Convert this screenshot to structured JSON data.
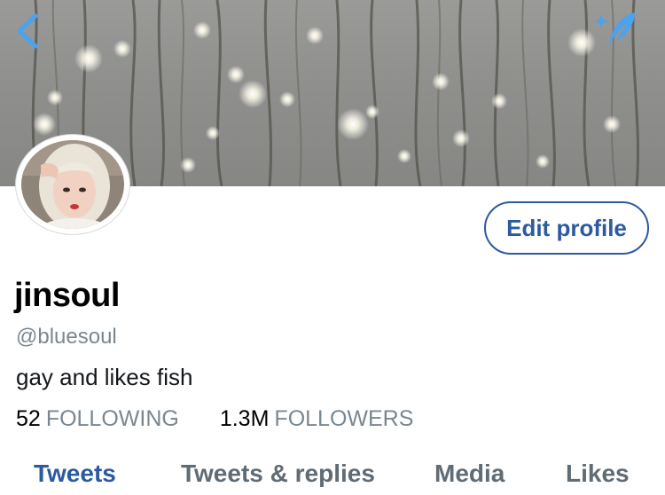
{
  "header": {
    "back_icon": "chevron-left-icon",
    "compose_icon": "feather-sparkle-icon",
    "accent_color": "#4aa3ee"
  },
  "profile": {
    "display_name": "jinsoul",
    "handle": "@bluesoul",
    "bio": "gay and likes fish",
    "edit_button_label": "Edit profile",
    "following_count": "52",
    "following_label": "FOLLOWING",
    "followers_count": "1.3M",
    "followers_label": "FOLLOWERS"
  },
  "tabs": [
    {
      "label": "Tweets",
      "active": true
    },
    {
      "label": "Tweets & replies",
      "active": false
    },
    {
      "label": "Media",
      "active": false
    },
    {
      "label": "Likes",
      "active": false
    }
  ],
  "colors": {
    "link_blue": "#2c5aa0",
    "muted_gray": "#7a8791"
  }
}
